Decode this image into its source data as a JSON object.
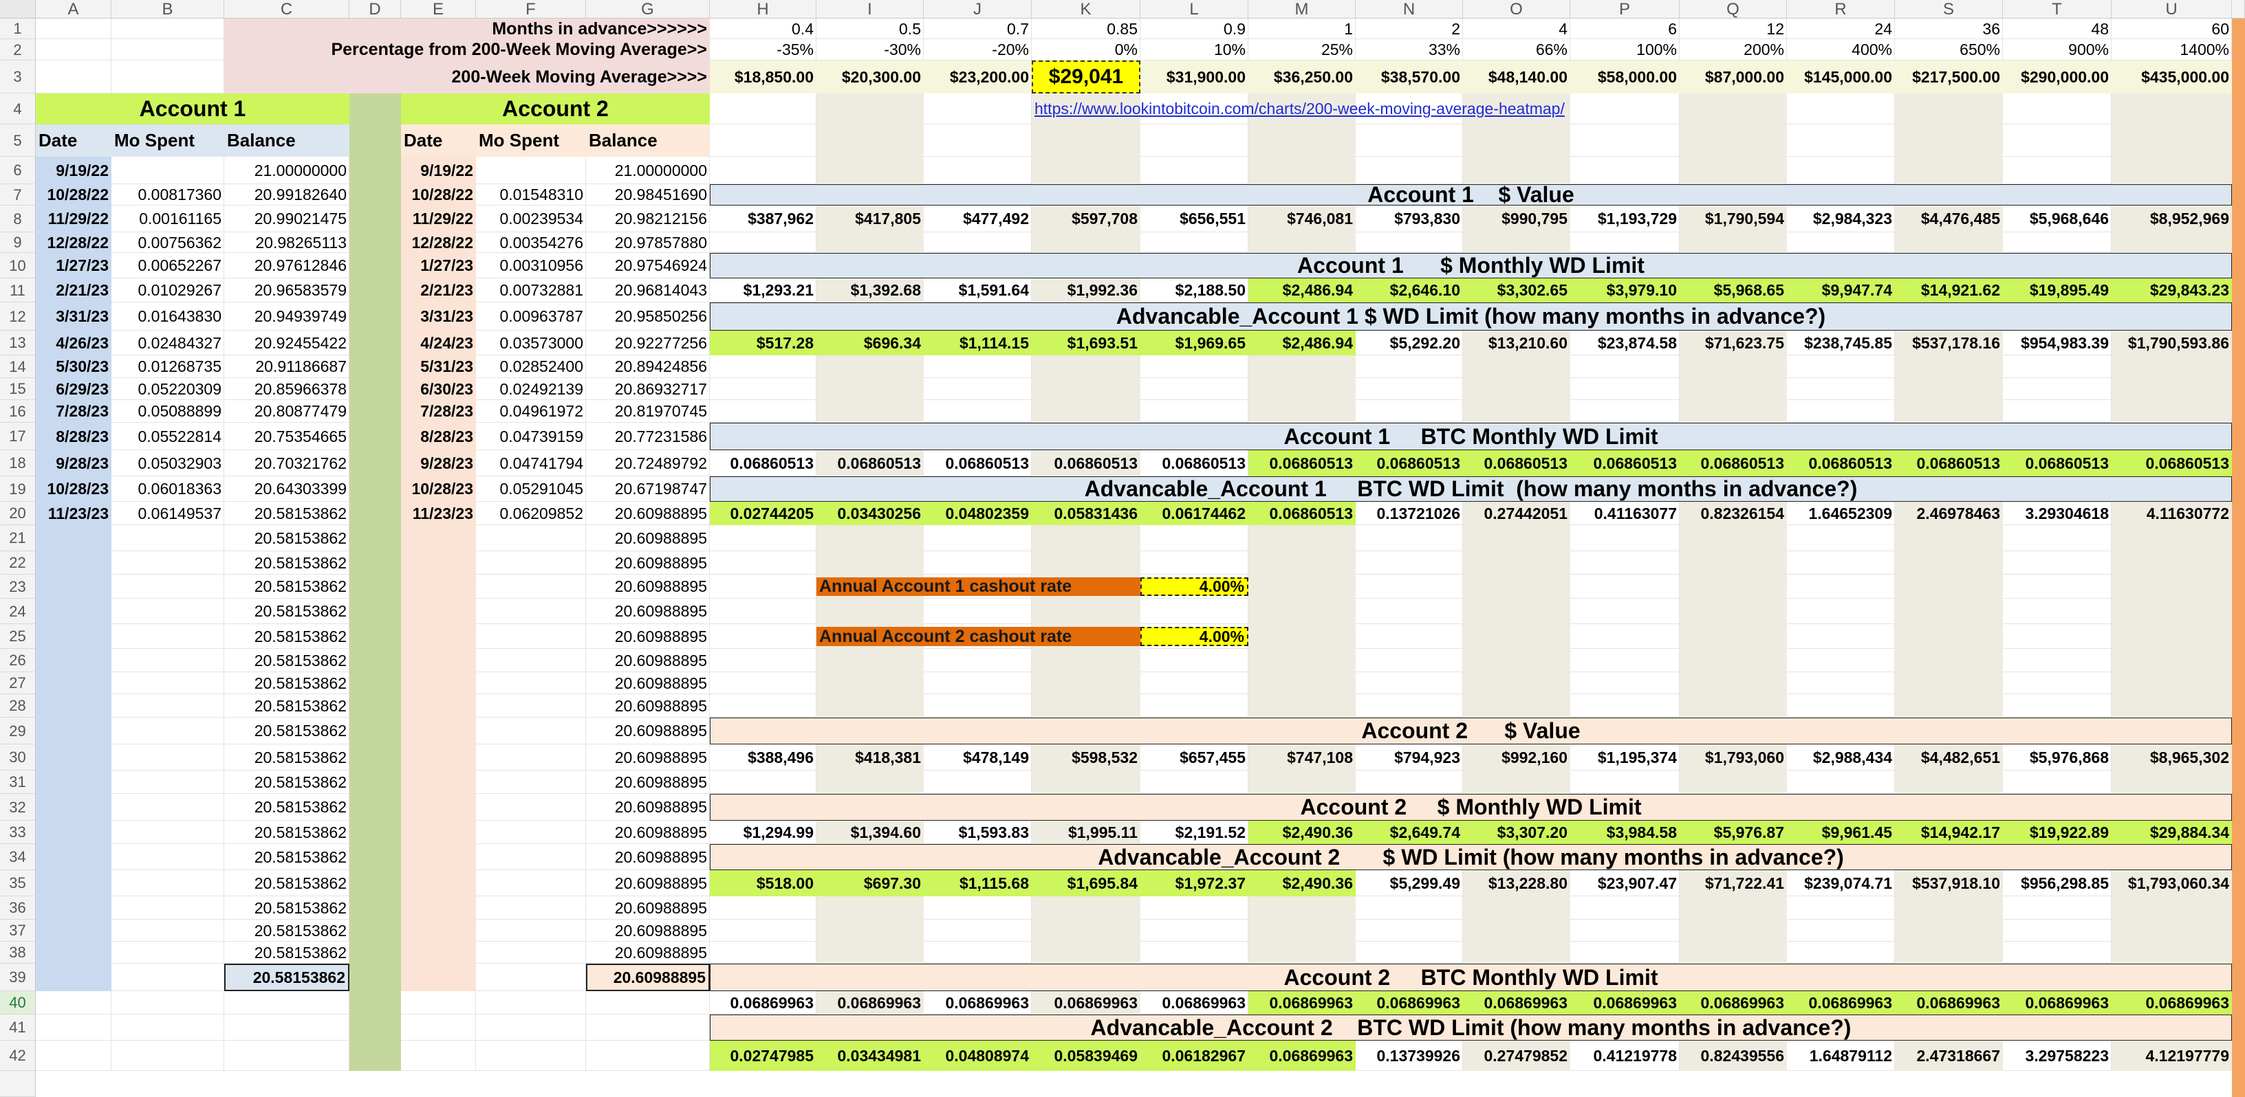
{
  "columns": [
    "A",
    "B",
    "C",
    "D",
    "E",
    "F",
    "G",
    "H",
    "I",
    "J",
    "K",
    "L",
    "M",
    "N",
    "O",
    "P",
    "Q",
    "R",
    "S",
    "T",
    "U"
  ],
  "rows": [
    "1",
    "2",
    "3",
    "4",
    "5",
    "6",
    "7",
    "8",
    "9",
    "10",
    "11",
    "12",
    "13",
    "14",
    "15",
    "16",
    "17",
    "18",
    "19",
    "20",
    "21",
    "22",
    "23",
    "24",
    "25",
    "26",
    "27",
    "28",
    "29",
    "30",
    "31",
    "32",
    "33",
    "34",
    "35",
    "36",
    "37",
    "38",
    "39",
    "40",
    "41",
    "42"
  ],
  "header": {
    "months_label": "Months in advance>>>>>>",
    "pct_label": "Percentage from 200-Week Moving Average>>",
    "ma_label": "200-Week Moving Average>>>>",
    "months": [
      "0.4",
      "0.5",
      "0.7",
      "0.85",
      "0.9",
      "1",
      "2",
      "4",
      "6",
      "12",
      "24",
      "36",
      "48",
      "60"
    ],
    "pcts": [
      "-35%",
      "-30%",
      "-20%",
      "0%",
      "10%",
      "25%",
      "33%",
      "66%",
      "100%",
      "200%",
      "400%",
      "650%",
      "900%",
      "1400%"
    ],
    "ma": [
      "$18,850.00",
      "$20,300.00",
      "$23,200.00",
      "$29,041",
      "$31,900.00",
      "$36,250.00",
      "$38,570.00",
      "$48,140.00",
      "$58,000.00",
      "$87,000.00",
      "$145,000.00",
      "$217,500.00",
      "$290,000.00",
      "$435,000.00"
    ]
  },
  "link": "https://www.lookintobitcoin.com/charts/200-week-moving-average-heatmap/",
  "account1": {
    "title": "Account 1",
    "headers": [
      "Date",
      "Mo Spent",
      "Balance"
    ],
    "start": {
      "date": "9/19/22",
      "balance": "21.00000000"
    },
    "rows": [
      [
        "10/28/22",
        "0.00817360",
        "20.99182640"
      ],
      [
        "11/29/22",
        "0.00161165",
        "20.99021475"
      ],
      [
        "12/28/22",
        "0.00756362",
        "20.98265113"
      ],
      [
        "1/27/23",
        "0.00652267",
        "20.97612846"
      ],
      [
        "2/21/23",
        "0.01029267",
        "20.96583579"
      ],
      [
        "3/31/23",
        "0.01643830",
        "20.94939749"
      ],
      [
        "4/26/23",
        "0.02484327",
        "20.92455422"
      ],
      [
        "5/30/23",
        "0.01268735",
        "20.91186687"
      ],
      [
        "6/29/23",
        "0.05220309",
        "20.85966378"
      ],
      [
        "7/28/23",
        "0.05088899",
        "20.80877479"
      ],
      [
        "8/28/23",
        "0.05522814",
        "20.75354665"
      ],
      [
        "9/28/23",
        "0.05032903",
        "20.70321762"
      ],
      [
        "10/28/23",
        "0.06018363",
        "20.64303399"
      ],
      [
        "11/23/23",
        "0.06149537",
        "20.58153862"
      ]
    ],
    "fill": "20.58153862"
  },
  "account2": {
    "title": "Account 2",
    "headers": [
      "Date",
      "Mo Spent",
      "Balance"
    ],
    "start": {
      "date": "9/19/22",
      "balance": "21.00000000"
    },
    "rows": [
      [
        "10/28/22",
        "0.01548310",
        "20.98451690"
      ],
      [
        "11/29/22",
        "0.00239534",
        "20.98212156"
      ],
      [
        "12/28/22",
        "0.00354276",
        "20.97857880"
      ],
      [
        "1/27/23",
        "0.00310956",
        "20.97546924"
      ],
      [
        "2/21/23",
        "0.00732881",
        "20.96814043"
      ],
      [
        "3/31/23",
        "0.00963787",
        "20.95850256"
      ],
      [
        "4/24/23",
        "0.03573000",
        "20.92277256"
      ],
      [
        "5/31/23",
        "0.02852400",
        "20.89424856"
      ],
      [
        "6/30/23",
        "0.02492139",
        "20.86932717"
      ],
      [
        "7/28/23",
        "0.04961972",
        "20.81970745"
      ],
      [
        "8/28/23",
        "0.04739159",
        "20.77231586"
      ],
      [
        "9/28/23",
        "0.04741794",
        "20.72489792"
      ],
      [
        "10/28/23",
        "0.05291045",
        "20.67198747"
      ],
      [
        "11/23/23",
        "0.06209852",
        "20.60988895"
      ]
    ],
    "fill": "20.60988895"
  },
  "bands": {
    "a1_value": "Account 1    $ Value",
    "a1_monthly": "Account 1      $ Monthly WD Limit",
    "a1_adv": "Advancable_Account 1 $ WD Limit (how many months in advance?)",
    "a1_btc": "Account 1     BTC Monthly WD Limit",
    "a1_btc_adv": "Advancable_Account 1     BTC WD Limit  (how many months in advance?)",
    "a2_value": "Account 2      $ Value",
    "a2_monthly": "Account 2     $ Monthly WD Limit",
    "a2_adv": "Advancable_Account 2       $ WD Limit (how many months in advance?)",
    "a2_btc": "Account 2     BTC Monthly WD Limit",
    "a2_btc_adv": "Advancable_Account 2    BTC WD Limit (how many months in advance?)"
  },
  "data": {
    "a1_value": [
      "$387,962",
      "$417,805",
      "$477,492",
      "$597,708",
      "$656,551",
      "$746,081",
      "$793,830",
      "$990,795",
      "$1,193,729",
      "$1,790,594",
      "$2,984,323",
      "$4,476,485",
      "$5,968,646",
      "$8,952,969"
    ],
    "a1_monthly": [
      "$1,293.21",
      "$1,392.68",
      "$1,591.64",
      "$1,992.36",
      "$2,188.50",
      "$2,486.94",
      "$2,646.10",
      "$3,302.65",
      "$3,979.10",
      "$5,968.65",
      "$9,947.74",
      "$14,921.62",
      "$19,895.49",
      "$29,843.23"
    ],
    "a1_adv": [
      "$517.28",
      "$696.34",
      "$1,114.15",
      "$1,693.51",
      "$1,969.65",
      "$2,486.94",
      "$5,292.20",
      "$13,210.60",
      "$23,874.58",
      "$71,623.75",
      "$238,745.85",
      "$537,178.16",
      "$954,983.39",
      "$1,790,593.86"
    ],
    "a1_btc": [
      "0.06860513",
      "0.06860513",
      "0.06860513",
      "0.06860513",
      "0.06860513",
      "0.06860513",
      "0.06860513",
      "0.06860513",
      "0.06860513",
      "0.06860513",
      "0.06860513",
      "0.06860513",
      "0.06860513",
      "0.06860513"
    ],
    "a1_btc_adv": [
      "0.02744205",
      "0.03430256",
      "0.04802359",
      "0.05831436",
      "0.06174462",
      "0.06860513",
      "0.13721026",
      "0.27442051",
      "0.41163077",
      "0.82326154",
      "1.64652309",
      "2.46978463",
      "3.29304618",
      "4.11630772"
    ],
    "a2_value": [
      "$388,496",
      "$418,381",
      "$478,149",
      "$598,532",
      "$657,455",
      "$747,108",
      "$794,923",
      "$992,160",
      "$1,195,374",
      "$1,793,060",
      "$2,988,434",
      "$4,482,651",
      "$5,976,868",
      "$8,965,302"
    ],
    "a2_monthly": [
      "$1,294.99",
      "$1,394.60",
      "$1,593.83",
      "$1,995.11",
      "$2,191.52",
      "$2,490.36",
      "$2,649.74",
      "$3,307.20",
      "$3,984.58",
      "$5,976.87",
      "$9,961.45",
      "$14,942.17",
      "$19,922.89",
      "$29,884.34"
    ],
    "a2_adv": [
      "$518.00",
      "$697.30",
      "$1,115.68",
      "$1,695.84",
      "$1,972.37",
      "$2,490.36",
      "$5,299.49",
      "$13,228.80",
      "$23,907.47",
      "$71,722.41",
      "$239,074.71",
      "$537,918.10",
      "$956,298.85",
      "$1,793,060.34"
    ],
    "a2_btc": [
      "0.06869963",
      "0.06869963",
      "0.06869963",
      "0.06869963",
      "0.06869963",
      "0.06869963",
      "0.06869963",
      "0.06869963",
      "0.06869963",
      "0.06869963",
      "0.06869963",
      "0.06869963",
      "0.06869963",
      "0.06869963"
    ],
    "a2_btc_adv": [
      "0.02747985",
      "0.03434981",
      "0.04808974",
      "0.05839469",
      "0.06182967",
      "0.06869963",
      "0.13739926",
      "0.27479852",
      "0.41219778",
      "0.82439556",
      "1.64879112",
      "2.47318667",
      "3.29758223",
      "4.12197779"
    ]
  },
  "cashout": {
    "a1_label": "Annual Account 1   cashout rate",
    "a1_rate": "4.00%",
    "a2_label": "Annual Account 2   cashout rate",
    "a2_rate": "4.00%"
  },
  "colors": {
    "lime": "#cdf55c",
    "green_col": "#c4d79b",
    "blue_col": "#c9d9ef",
    "peach_col": "#fbe4d5",
    "pink_hdr": "#f2dcdb",
    "yellow": "#ffff00",
    "orange": "#e26b0a",
    "band_blue": "#dce6f1",
    "band_peach": "#fde9d9",
    "stripe": "#eeece1",
    "right_bar": "#f4a460"
  }
}
